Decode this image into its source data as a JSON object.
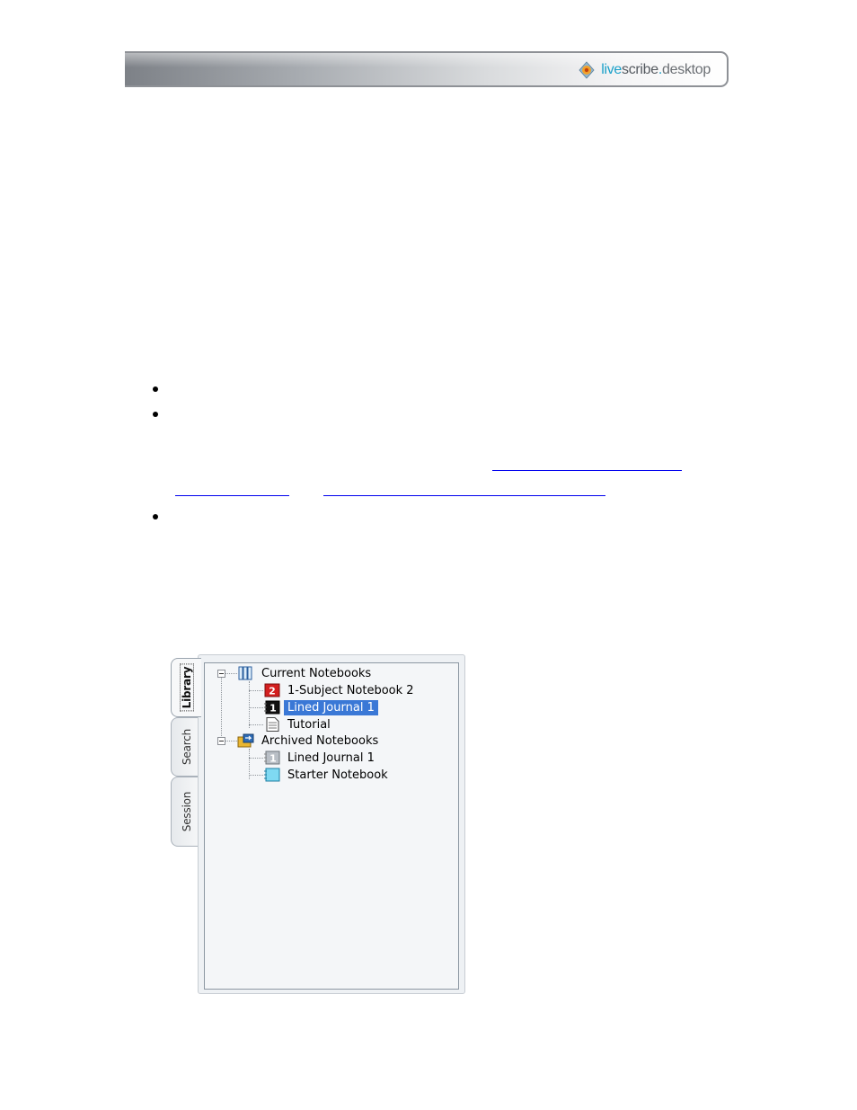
{
  "header": {
    "brand_live": "live",
    "brand_scribe": "scribe",
    "brand_dot": ".",
    "brand_desktop": "desktop"
  },
  "library_panel": {
    "tabs": [
      {
        "label": "Library",
        "active": true
      },
      {
        "label": "Search",
        "active": false
      },
      {
        "label": "Session",
        "active": false
      }
    ],
    "tree": {
      "current_notebooks": {
        "label": "Current Notebooks",
        "items": [
          {
            "label": "1-Subject Notebook 2",
            "badge": "2",
            "icon": "red-notebook-icon"
          },
          {
            "label": "Lined Journal 1",
            "badge": "1",
            "icon": "black-journal-icon",
            "selected": true
          },
          {
            "label": "Tutorial",
            "icon": "document-icon"
          }
        ]
      },
      "archived_notebooks": {
        "label": "Archived Notebooks",
        "items": [
          {
            "label": "Lined Journal 1",
            "badge": "1",
            "icon": "gray-journal-icon"
          },
          {
            "label": "Starter Notebook",
            "icon": "cyan-notebook-icon"
          }
        ]
      }
    }
  },
  "colors": {
    "selection": "#3a78d6",
    "link": "#0000ee",
    "brand_accent": "#1aa0c9"
  }
}
